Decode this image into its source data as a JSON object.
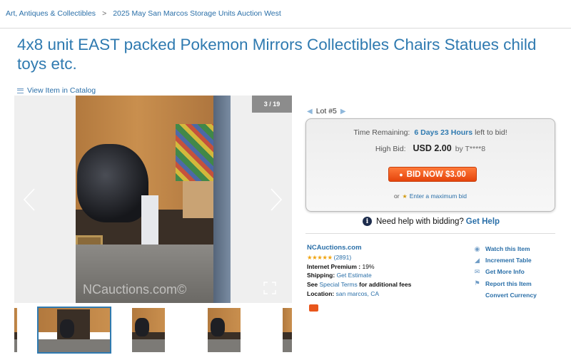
{
  "breadcrumb": {
    "category": "Art, Antiques & Collectibles",
    "separator": ">",
    "auction": "2025 May San Marcos Storage Units Auction West"
  },
  "title": "4x8 unit EAST packed Pokemon Mirrors Collectibles Chairs Statues child toys etc.",
  "catalog_link": "View Item in Catalog",
  "gallery": {
    "counter": "3 / 19",
    "watermark": "NCauctions.com©",
    "thumbnail_count": 4
  },
  "lot": {
    "label": "Lot #5"
  },
  "bid_box": {
    "time_label": "Time Remaining:",
    "time_value": "6 Days 23 Hours",
    "time_suffix": "left to bid!",
    "high_bid_label": "High Bid:",
    "high_bid_amount": "USD 2.00",
    "high_bidder": "by T****8",
    "bid_now_label": "BID NOW $3.00",
    "or_text": "or",
    "max_bid_link": "Enter a maximum bid"
  },
  "help": {
    "text": "Need help with bidding?",
    "link": "Get Help"
  },
  "seller": {
    "name": "NCAuctions.com",
    "stars": "★★★★★",
    "rating_count": "(2891)",
    "premium_label": "Internet Premium :",
    "premium_value": "19%",
    "shipping_label": "Shipping:",
    "shipping_link": "Get Estimate",
    "terms_prefix": "See",
    "terms_link": "Special Terms",
    "terms_suffix": "for additional fees",
    "location_label": "Location:",
    "location_value": "san marcos, CA"
  },
  "actions": {
    "watch": "Watch this Item",
    "increment": "Increment Table",
    "info": "Get More Info",
    "report": "Report this Item",
    "currency": "Convert Currency"
  },
  "colors": {
    "link": "#2a6fa8",
    "title": "#2f7ab0",
    "bid_button": "#e5450c",
    "stars": "#f0a411"
  },
  "icons": {
    "prev": "chevron-left-icon",
    "next": "chevron-right-icon",
    "fullscreen": "expand-icon",
    "info": "info-icon",
    "watch": "eye-icon",
    "increment": "chart-icon",
    "get_info": "mail-icon",
    "report": "flag-icon"
  }
}
